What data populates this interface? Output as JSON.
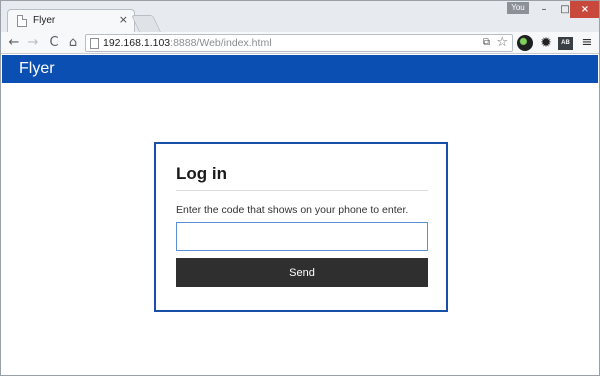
{
  "browser": {
    "tab_title": "Flyer",
    "tab_close": "×",
    "user_badge": "You",
    "window_controls": {
      "minimize": "–",
      "maximize": "□",
      "close": "×"
    },
    "nav": {
      "back": "←",
      "forward": "→",
      "reload": "C",
      "home": "⌂"
    },
    "url_host": "192.168.1.103",
    "url_rest": ":8888/Web/index.html",
    "extensions": {
      "menu": "≡",
      "ext3_label": "AB",
      "settings": "✹"
    }
  },
  "app": {
    "title": "Flyer",
    "header_color": "#0b4fb3"
  },
  "login": {
    "heading": "Log in",
    "instruction": "Enter the code that shows on your phone to enter.",
    "code_value": "",
    "send_label": "Send"
  }
}
